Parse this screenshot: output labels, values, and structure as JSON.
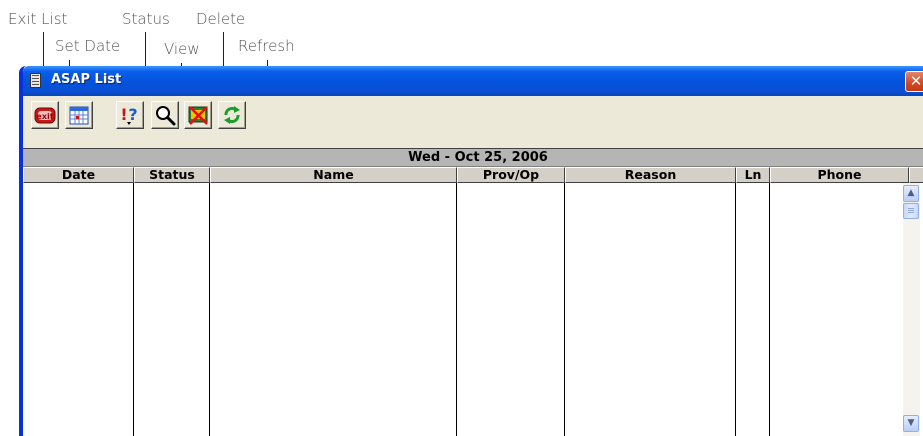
{
  "callouts": {
    "exit_list": "Exit List",
    "set_date": "Set Date",
    "status": "Status",
    "delete": "Delete",
    "view": "View",
    "refresh": "Refresh"
  },
  "window": {
    "title": "ASAP List",
    "close_glyph": "✕"
  },
  "toolbar": {
    "buttons": [
      {
        "name": "exit-list",
        "icon": "exit-icon",
        "tooltip": "Exit List"
      },
      {
        "name": "set-date",
        "icon": "calendar-icon",
        "tooltip": "Set Date"
      },
      {
        "name": "status",
        "icon": "status-icon",
        "tooltip": "Status"
      },
      {
        "name": "view",
        "icon": "magnifier-icon",
        "tooltip": "View"
      },
      {
        "name": "delete",
        "icon": "delete-icon",
        "tooltip": "Delete"
      },
      {
        "name": "refresh",
        "icon": "refresh-icon",
        "tooltip": "Refresh"
      }
    ]
  },
  "list": {
    "date_banner": "Wed - Oct 25, 2006",
    "columns": [
      "Date",
      "Status",
      "Name",
      "Prov/Op",
      "Reason",
      "Ln",
      "Phone"
    ],
    "rows": []
  },
  "colors": {
    "titlebar": "#0552dc",
    "window_bg": "#ece9d8",
    "header_bg": "#d4d0c8",
    "date_banner_bg": "#b5b5b5",
    "close_button": "#d2471f"
  }
}
